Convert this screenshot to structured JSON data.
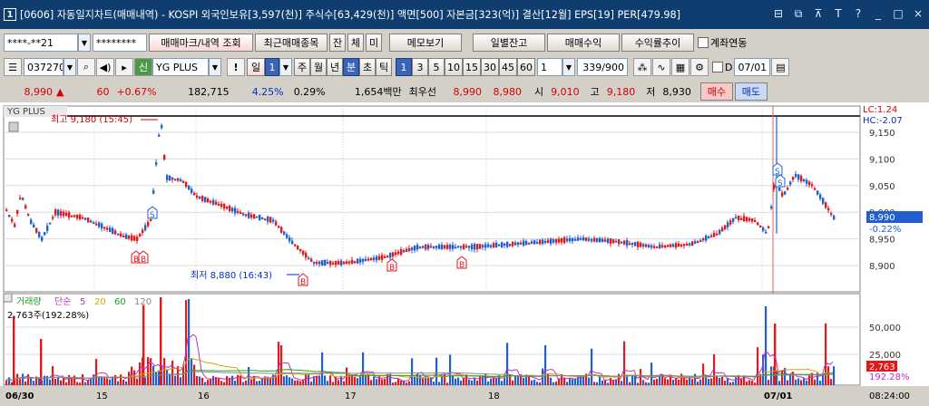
{
  "titlebar": {
    "num": "1",
    "text": "[0606] 자동일지차트(매매내역) - KOSPI 외국인보유[3,597(천)] 주식수[63,429(천)] 액면[500] 자본금[323(억)] 결산[12월] EPS[19] PER[479.98]"
  },
  "toolbar1": {
    "account": "****-**21",
    "password": "********",
    "btn_trade_mark": "매매마크/내역 조회",
    "btn_recent": "최근매매종목",
    "btn_jan": "잔",
    "btn_che": "체",
    "btn_mi": "미",
    "btn_memo": "메모보기",
    "btn_daily": "일별잔고",
    "btn_profit": "매매수익",
    "btn_rate": "수익률추이",
    "chk_linked": "계좌연동"
  },
  "toolbar2": {
    "code": "037270",
    "market_tag": "신",
    "stock_name": "YG PLUS",
    "period_il": "일",
    "period_val": "1",
    "p_ju": "주",
    "p_wol": "월",
    "p_nyeon": "년",
    "p_bun": "분",
    "p_cho": "초",
    "p_tick": "틱",
    "minutes": [
      "1",
      "3",
      "5",
      "10",
      "15",
      "30",
      "45",
      "60"
    ],
    "count_val": "1",
    "count_range": "339/900",
    "d_label": "D",
    "date": "07/01"
  },
  "quote": {
    "price": "8,990",
    "arrow": "▲",
    "change": "60",
    "change_pct": "+0.67%",
    "volume": "182,715",
    "vol_pct": "4.25%",
    "turnover_pct": "0.29%",
    "amount": "1,654백만",
    "best_label": "최우선",
    "best_sell": "8,990",
    "best_buy": "8,980",
    "open_label": "시",
    "open": "9,010",
    "high_label": "고",
    "high": "9,180",
    "low_label": "저",
    "low": "8,930",
    "buy_btn": "매수",
    "sell_btn": "매도"
  },
  "chart": {
    "name": "YG PLUS",
    "high_note": "최고 9,180 (15:45)",
    "low_note": "최저 8,880 (16:43)",
    "lc": "LC:1.24",
    "hc": "HC:-2.07",
    "price_ticks": [
      "9,150",
      "9,100",
      "9,050",
      "9,000",
      "8,950",
      "8,900"
    ],
    "cur_price": "8,990",
    "cur_pct": "-0.22%",
    "vol_legend": {
      "label": "거래량",
      "simple": "단순",
      "ma": [
        "5",
        "20",
        "60",
        "120"
      ]
    },
    "vol_info": "2,763주(192.28%)",
    "vol_ticks": [
      "50,000",
      "25,000"
    ],
    "cur_vol": "2,763",
    "cur_vol_pct": "192.28%",
    "x_labels": [
      "06/30",
      "15",
      "16",
      "17",
      "18",
      "07/01"
    ],
    "time_label": "08:24:00",
    "colors": {
      "up": "#e0191c",
      "down": "#1f5fd0",
      "ma5": "#c030c0",
      "ma20": "#e0a000",
      "ma60": "#20a020",
      "ma120": "#888888"
    }
  }
}
